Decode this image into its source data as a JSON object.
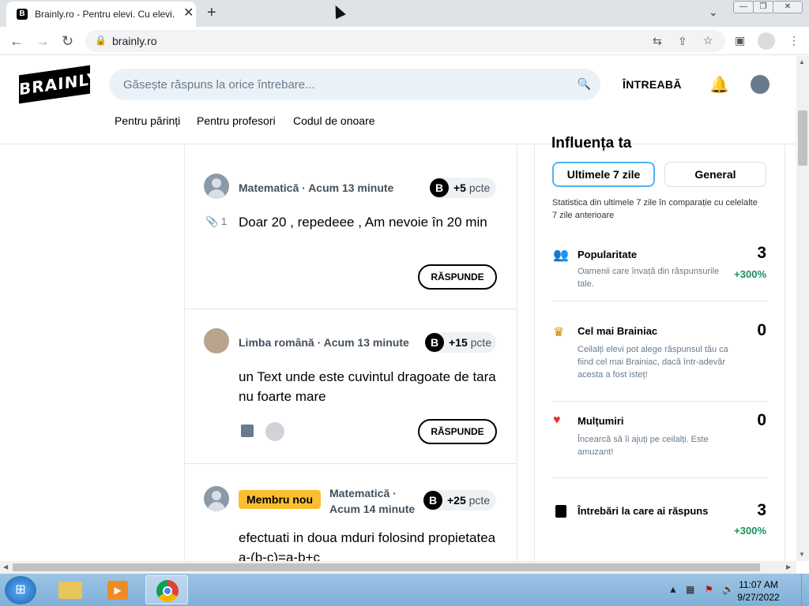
{
  "browser": {
    "tab_title": "Brainly.ro - Pentru elevi. Cu elevi.",
    "tab_favicon": "B",
    "tab_close": "✕",
    "new_tab": "+",
    "url": "brainly.ro"
  },
  "header": {
    "logo": "BRAINLY",
    "search_placeholder": "Găsește răspuns la orice întrebare...",
    "ask_label": "ÎNTREABĂ",
    "nav": [
      "Pentru părinți",
      "Pentru profesori",
      "Codul de onoare"
    ]
  },
  "questions": [
    {
      "subject": "Matematică",
      "time": "Acum 13 minute",
      "points": "+5",
      "points_unit": "pcte",
      "attachments": "1",
      "text": "Doar 20 , repedeee , Am nevoie în 20 min",
      "answer_label": "RĂSPUNDE"
    },
    {
      "subject": "Limba română",
      "time": "Acum 13 minute",
      "points": "+15",
      "points_unit": "pcte",
      "text": "un Text unde este cuvintul dragoate de tara nu foarte mare",
      "answer_label": "RĂSPUNDE"
    },
    {
      "badge": "Membru nou",
      "subject": "Matematică ·",
      "time": "Acum 14 minute",
      "points": "+25",
      "points_unit": "pcte",
      "text": "efectuati in doua mduri folosind propietatea a-(b-c)=a-b+c"
    }
  ],
  "stats": {
    "title": "Influența ta",
    "tab_week": "Ultimele 7 zile",
    "tab_general": "General",
    "description": "Statistica din ultimele 7 zile în comparație cu celelalte 7 zile anterioare",
    "items": [
      {
        "icon": "people-icon",
        "title": "Popularitate",
        "desc": "Oamenii care învață din răspunsurile tale.",
        "value": "3",
        "change": "+300%"
      },
      {
        "icon": "crown-icon",
        "title": "Cel mai Brainiac",
        "desc": "Ceilalți elevi pot alege răspunsul tău ca fiind cel mai Brainiac, dacă într-adevăr acesta a fost isteț!",
        "value": "0"
      },
      {
        "icon": "heart-icon",
        "title": "Mulțumiri",
        "desc": "Încearcă să îi ajuți pe ceilalți. Este amuzant!",
        "value": "0"
      },
      {
        "icon": "document-icon",
        "title": "Întrebări la care ai răspuns",
        "value": "3",
        "change": "+300%"
      }
    ]
  },
  "taskbar": {
    "time": "11:07 AM",
    "date": "9/27/2022"
  },
  "colors": {
    "accent_blue": "#4fb3f6",
    "badge_yellow": "#fbbe2e",
    "green": "#1a8f5c",
    "heart_red": "#e8322f",
    "crown_gold": "#c98600",
    "people_blue": "#2f7ed8"
  }
}
